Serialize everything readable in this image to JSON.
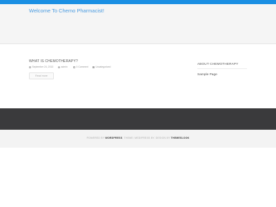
{
  "header": {
    "site_title": "Welcome To Chemo Pharmacist!"
  },
  "post": {
    "title": "WHAT IS CHEMOTHERAPY?",
    "date": "September 24, 2013",
    "author": "admin",
    "comments": "0 Comment",
    "category": "Uncategorized",
    "read_more": "Read more"
  },
  "sidebar": {
    "widget_title": "ABOUT CHEMOTHERAPY",
    "link": "Sample Page"
  },
  "footer": {
    "powered_by": "POWERED BY",
    "wordpress": "WORDPRESS",
    "theme_text": ", THEME: MEDIPRESS BY. DESIGN BY",
    "themeslook": "THEMESLOOK"
  },
  "colors": {
    "accent": "#1a8fe3",
    "footer_dark": "#3a3a3c"
  }
}
